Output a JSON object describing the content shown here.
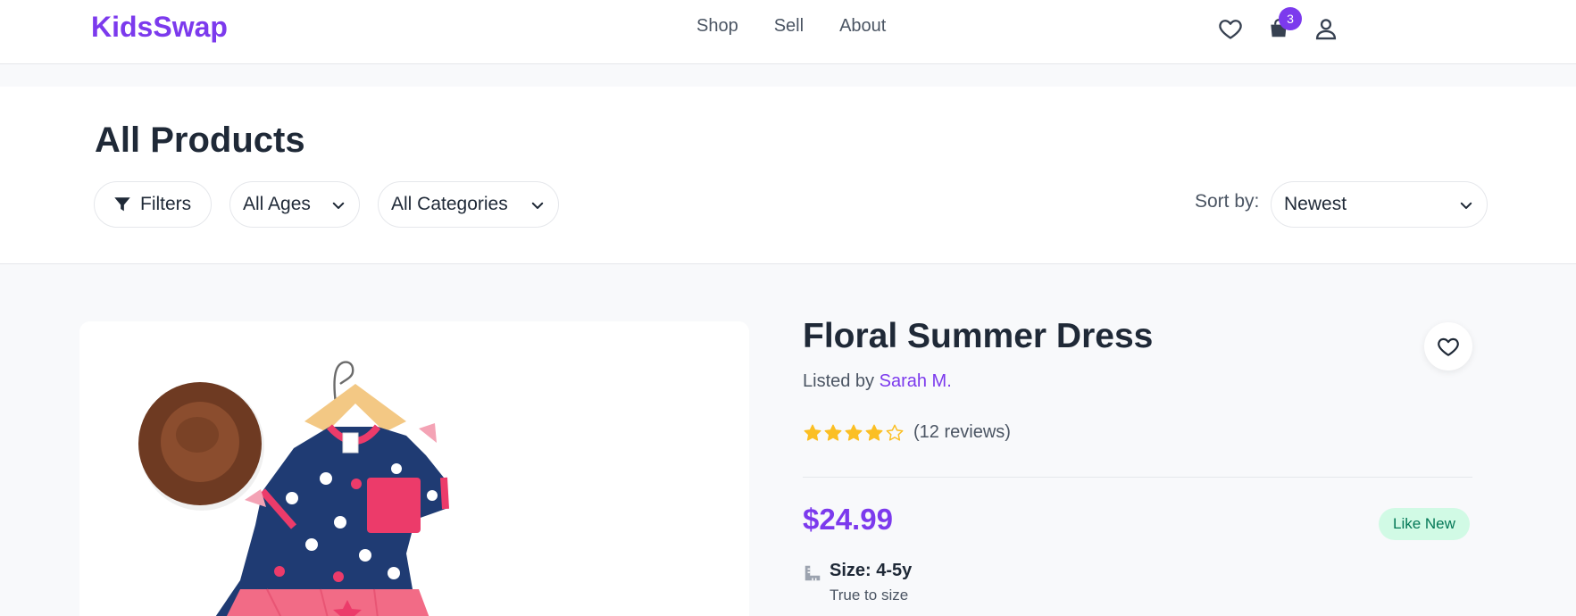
{
  "brand": {
    "name": "KidsSwap"
  },
  "nav": {
    "links": [
      "Shop",
      "Sell",
      "About"
    ],
    "cart_count": "3"
  },
  "page": {
    "title": "All Products"
  },
  "filters": {
    "filters_label": "Filters",
    "ages_label": "All Ages",
    "categories_label": "All Categories",
    "sort_label": "Sort by:",
    "sort_value": "Newest"
  },
  "product": {
    "title": "Floral Summer Dress",
    "listed_prefix": "Listed by",
    "seller": "Sarah M.",
    "rating": 4,
    "reviews": "(12 reviews)",
    "price": "$24.99",
    "condition": "Like New",
    "size_label": "Size: 4-5y",
    "size_note": "True to size"
  },
  "colors": {
    "accent": "#7c3aed",
    "star": "#fbbf24",
    "badge_bg": "#d1fae5",
    "badge_text": "#047857"
  },
  "icons": {
    "wishlist": "heart-icon",
    "cart": "shopping-bag-icon",
    "account": "user-icon",
    "filter": "funnel-icon",
    "dropdown": "chevron-down-icon",
    "size": "ruler-icon"
  }
}
